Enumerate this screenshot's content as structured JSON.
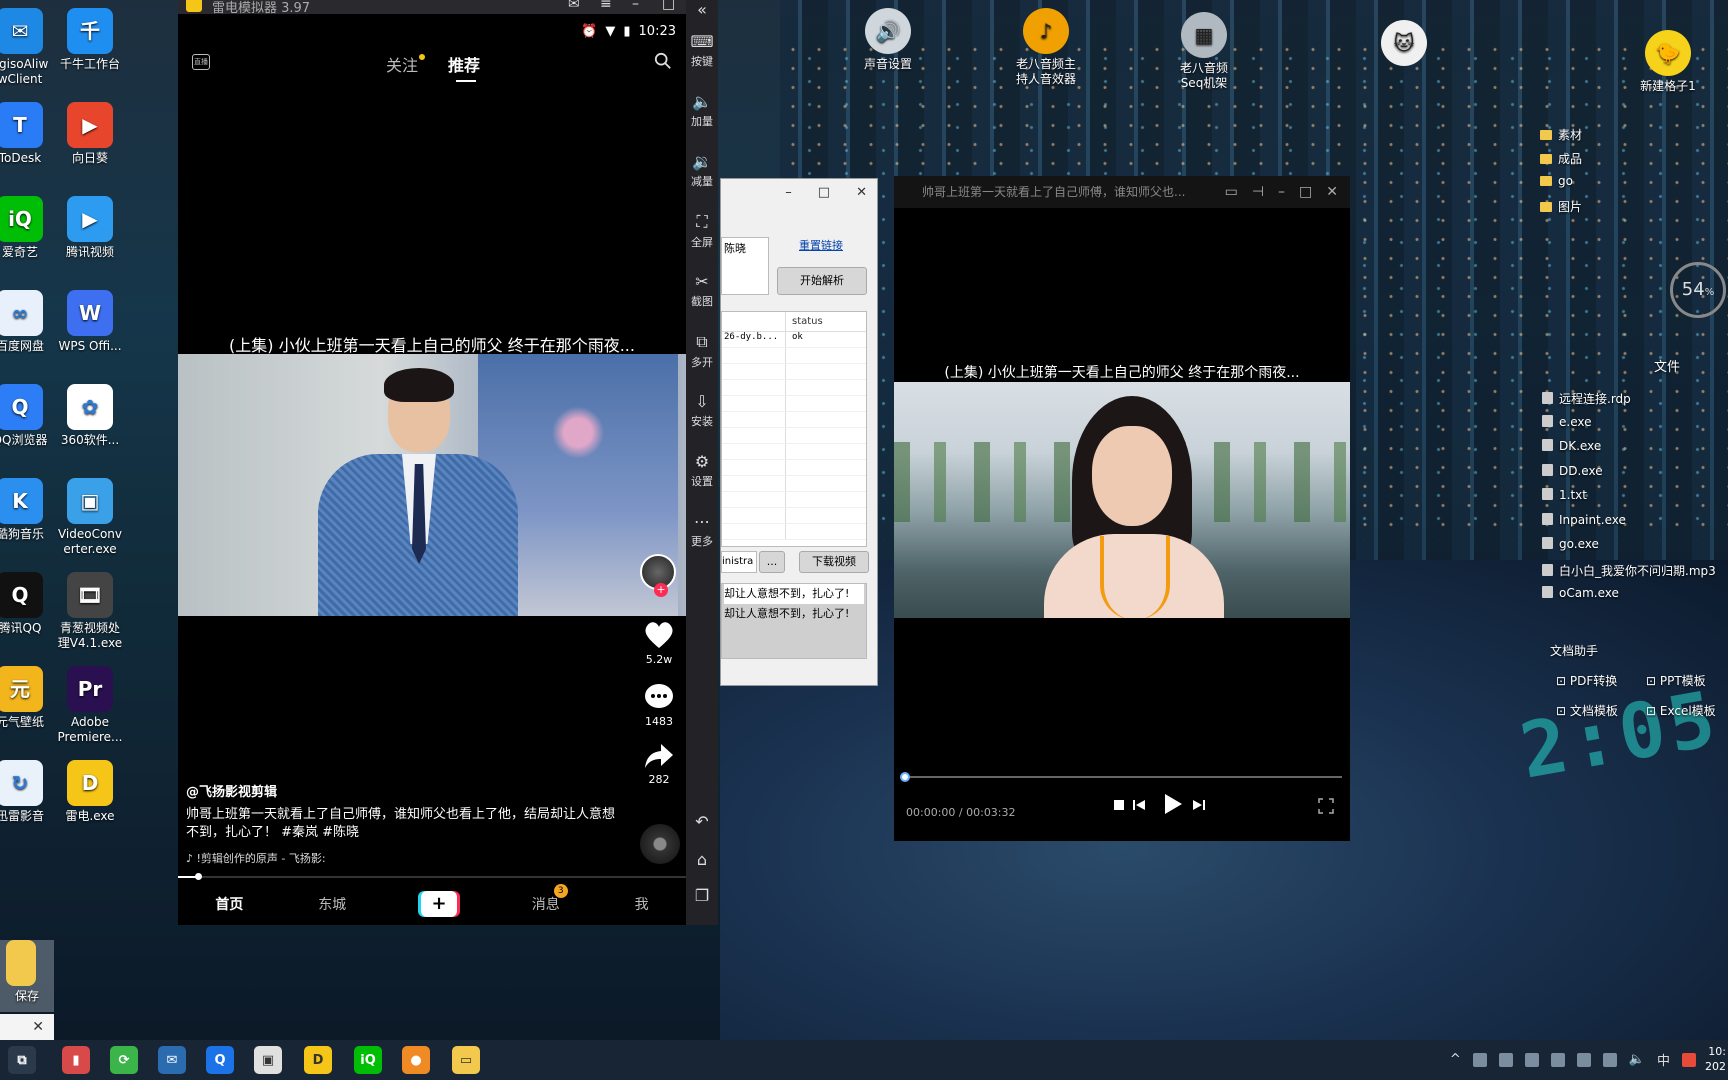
{
  "desktop_left": [
    {
      "label": "agisoAliwwClient",
      "label_l1": "agisoAliw",
      "label_l2": "wClient",
      "color": "#1e88e5",
      "glyph": "✉"
    },
    {
      "label": "千牛工作台",
      "color": "#1f8ef1",
      "glyph": "千"
    },
    {
      "label": "ToDesk",
      "color": "#2a7bf6",
      "glyph": "T"
    },
    {
      "label": "向日葵",
      "color": "#e8452d",
      "glyph": "▶"
    },
    {
      "label": "爱奇艺",
      "color": "#00be06",
      "glyph": "iQ"
    },
    {
      "label": "腾讯视频",
      "color": "#2c9bf0",
      "glyph": "▶"
    },
    {
      "label": "百度网盘",
      "color": "#e8f1fb",
      "glyph": "∞"
    },
    {
      "label": "WPS Offi...",
      "color": "#3d6ff0",
      "glyph": "W"
    },
    {
      "label": "QQ浏览器",
      "color": "#2d7df6",
      "glyph": "Q"
    },
    {
      "label": "360软件...",
      "color": "#ffffff",
      "glyph": "✿"
    },
    {
      "label": "酷狗音乐",
      "color": "#2b8ff0",
      "glyph": "K"
    },
    {
      "label": "VideoConverter.exe",
      "label_l1": "VideoConv",
      "label_l2": "erter.exe",
      "color": "#3aa0e8",
      "glyph": "▣"
    },
    {
      "label": "腾讯QQ",
      "color": "#111111",
      "glyph": "Q"
    },
    {
      "label": "青葱视频处理V4.1.exe",
      "label_l1": "青葱视频处",
      "label_l2": "理V4.1.exe",
      "color": "#444444",
      "glyph": "🎞"
    },
    {
      "label": "元气壁纸",
      "color": "#f2b51c",
      "glyph": "元"
    },
    {
      "label": "Adobe Premiere...",
      "label_l1": "Adobe",
      "label_l2": "Premiere...",
      "color": "#2a1050",
      "glyph": "Pr"
    },
    {
      "label": "迅雷影音",
      "color": "#e9f1fb",
      "glyph": "↻"
    },
    {
      "label": "雷电.exe",
      "color": "#f5c518",
      "glyph": "D"
    },
    {
      "label": "保存",
      "color": "#f2c94c",
      "glyph": ""
    }
  ],
  "desktop_top": [
    {
      "label_l1": "声音设置",
      "label_l2": "",
      "color": "#cfd6dc",
      "glyph": "🔊"
    },
    {
      "label_l1": "老八音频主",
      "label_l2": "持人音效器",
      "color": "#f0a000",
      "glyph": "♪"
    },
    {
      "label_l1": "老八音频",
      "label_l2": "Seq机架",
      "color": "#b0b8c0",
      "glyph": "▦"
    },
    {
      "label_l1": "",
      "label_l2": "",
      "color": "#f0f0f0",
      "glyph": "🐱"
    },
    {
      "label_l1": "新建格子1",
      "label_l2": "",
      "color": "#f7d21a",
      "glyph": "🐤"
    }
  ],
  "emulator": {
    "title": "雷电模拟器 3.97",
    "time": "10:23",
    "tabs": {
      "follow": "关注",
      "recommend": "推荐"
    },
    "live_icon": "直播",
    "video_title": "(上集) 小伙上班第一天看上自己的师父  终于在那个雨夜...",
    "likes": "5.2w",
    "comments": "1483",
    "shares": "282",
    "author": "@飞扬影视剪辑",
    "description_l1": "帅哥上班第一天就看上了自己师傅，谁知师父也看上了他，结局却让人意想",
    "description_l2": "不到，扎心了！ #秦岚 #陈晓",
    "music": "♪ !剪辑创作的原声 - 飞扬影:",
    "progress": 0.04,
    "nav": {
      "home": "首页",
      "city": "东城",
      "create": "+",
      "messages": "消息",
      "messages_badge": "3",
      "me": "我"
    },
    "tools": [
      {
        "glyph": "⌨",
        "label": "按键"
      },
      {
        "glyph": "🔈",
        "label": "加量"
      },
      {
        "glyph": "🔉",
        "label": "减量"
      },
      {
        "glyph": "⛶",
        "label": "全屏"
      },
      {
        "glyph": "✂",
        "label": "截图"
      },
      {
        "glyph": "⧉",
        "label": "多开"
      },
      {
        "glyph": "⇩",
        "label": "安装"
      },
      {
        "glyph": "⚙",
        "label": "设置"
      },
      {
        "glyph": "⋯",
        "label": "更多"
      }
    ]
  },
  "downloader": {
    "input_text": "陈晓",
    "reset_link": "重置链接",
    "start_button": "开始解析",
    "table_header_status": "status",
    "table_row_name": "26-dy.b...",
    "table_row_status": "ok",
    "path_value": "inistra",
    "browse_button": "...",
    "download_button": "下载视频",
    "log_line1": "却让人意想不到，扎心了!",
    "log_line2": "却让人意想不到，扎心了!"
  },
  "player": {
    "title": "帅哥上班第一天就看上了自己师傅，谁知师父也...",
    "caption": "(上集) 小伙上班第一天看上自己的师父  终于在那个雨夜...",
    "time_current": "00:00:00 /",
    "time_total": "00:03:32",
    "progress": 0.0
  },
  "right_panel": {
    "folders": [
      "素材",
      "成品",
      "go",
      "图片"
    ],
    "files_title": "文件",
    "files": [
      "远程连接.rdp",
      "e.exe",
      "DK.exe",
      "DD.exe",
      "1.txt",
      "Inpaint.exe",
      "go.exe",
      "白小白_我爱你不问归期.mp3",
      "oCam.exe"
    ],
    "doc_title": "文档助手",
    "doc_tools": [
      "PDF转换",
      "PPT模板",
      "文档模板",
      "Excel模板"
    ],
    "gauge_value": "54",
    "gauge_unit": "%"
  },
  "taskbar": {
    "apps": [
      {
        "name": "taskview",
        "color": "#2b3a4a",
        "glyph": "⧉"
      },
      {
        "name": "app-red",
        "color": "#d84a4a",
        "glyph": "▮"
      },
      {
        "name": "app-green",
        "color": "#3bb54a",
        "glyph": "⟳"
      },
      {
        "name": "mail",
        "color": "#2b6cb0",
        "glyph": "✉"
      },
      {
        "name": "qq-browser",
        "color": "#1c73e8",
        "glyph": "Q"
      },
      {
        "name": "photo",
        "color": "#e0e0e0",
        "glyph": "▣"
      },
      {
        "name": "leidian",
        "color": "#f5c518",
        "glyph": "D"
      },
      {
        "name": "iqiyi",
        "color": "#00be06",
        "glyph": "iQ"
      },
      {
        "name": "app-orange",
        "color": "#f08a24",
        "glyph": "●"
      },
      {
        "name": "explorer",
        "color": "#f2c94c",
        "glyph": "▭"
      }
    ],
    "ime": "中",
    "clock_l1": "10:",
    "clock_l2": "202"
  },
  "notify_close": "✕"
}
